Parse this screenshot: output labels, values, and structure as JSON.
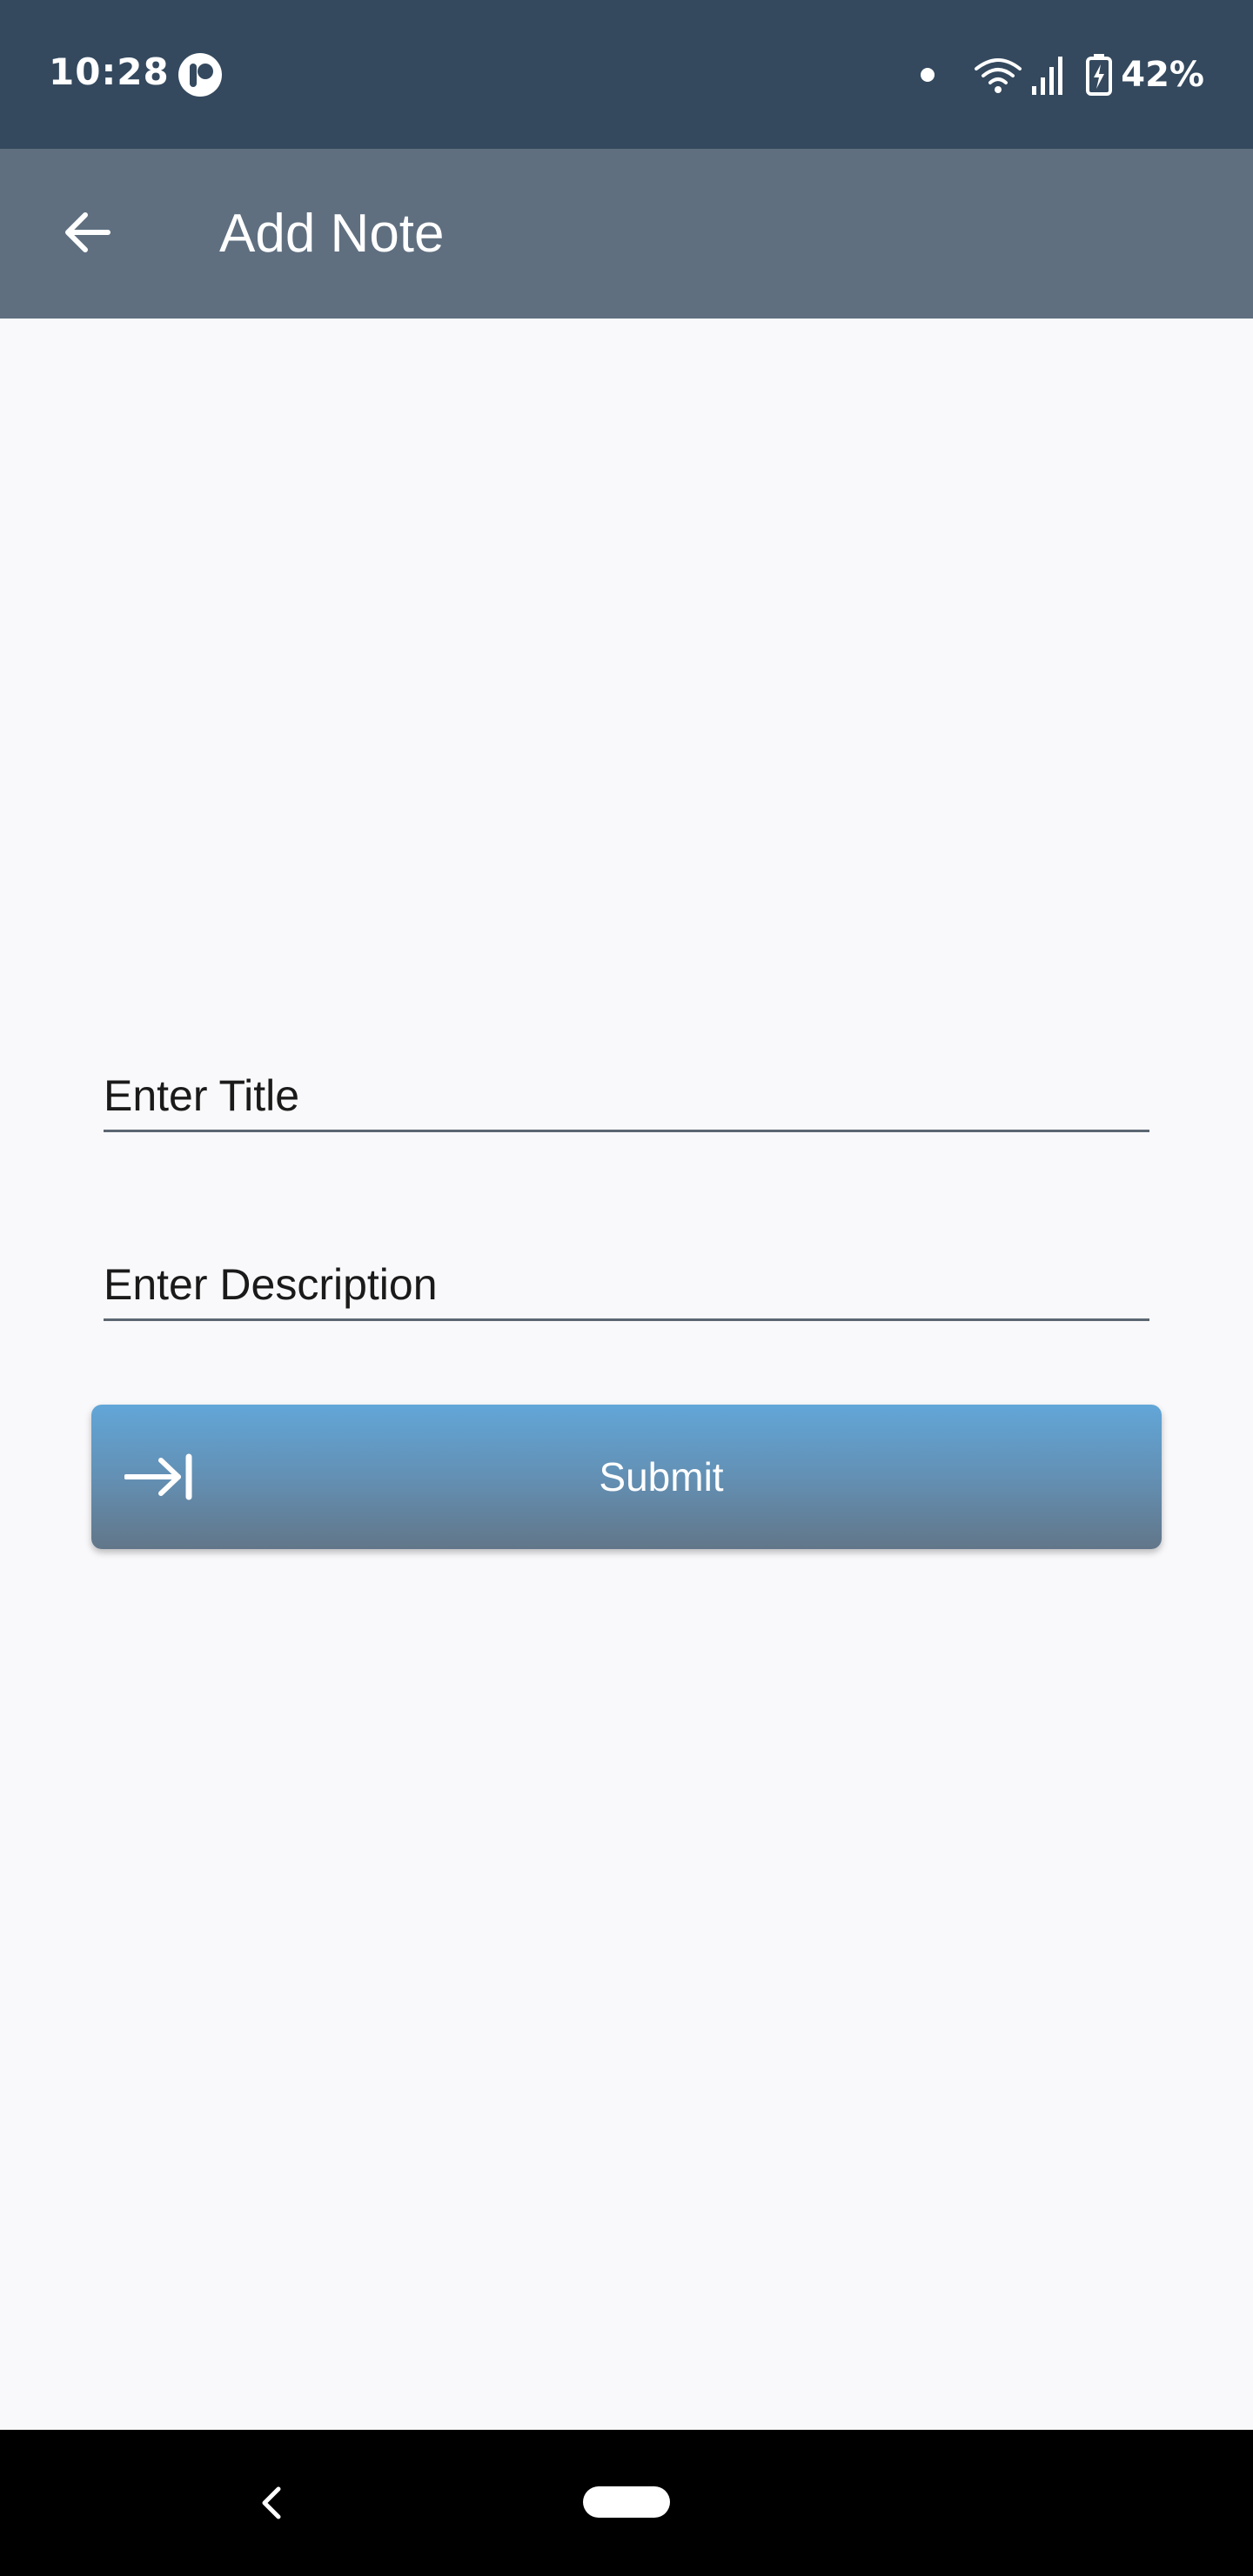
{
  "status_bar": {
    "time": "10:28",
    "battery": "42%",
    "icons": [
      "app-notification-icon",
      "dot-icon",
      "wifi-icon",
      "signal-icon",
      "battery-charging-icon"
    ]
  },
  "app_bar": {
    "title": "Add Note",
    "back_icon": "arrow-back-icon"
  },
  "form": {
    "title_placeholder": "Enter Title",
    "title_value": "",
    "description_placeholder": "Enter Description",
    "description_value": "",
    "submit_label": "Submit",
    "submit_icon": "arrow-right-to-bar-icon"
  },
  "nav_bar": {
    "icons": [
      "nav-back-icon",
      "home-pill"
    ]
  },
  "colors": {
    "status_bar": "#34495e",
    "app_bar": "#5f6f80",
    "background": "#f9f9fb",
    "button_top": "#62a6d8",
    "button_bottom": "#627689"
  }
}
